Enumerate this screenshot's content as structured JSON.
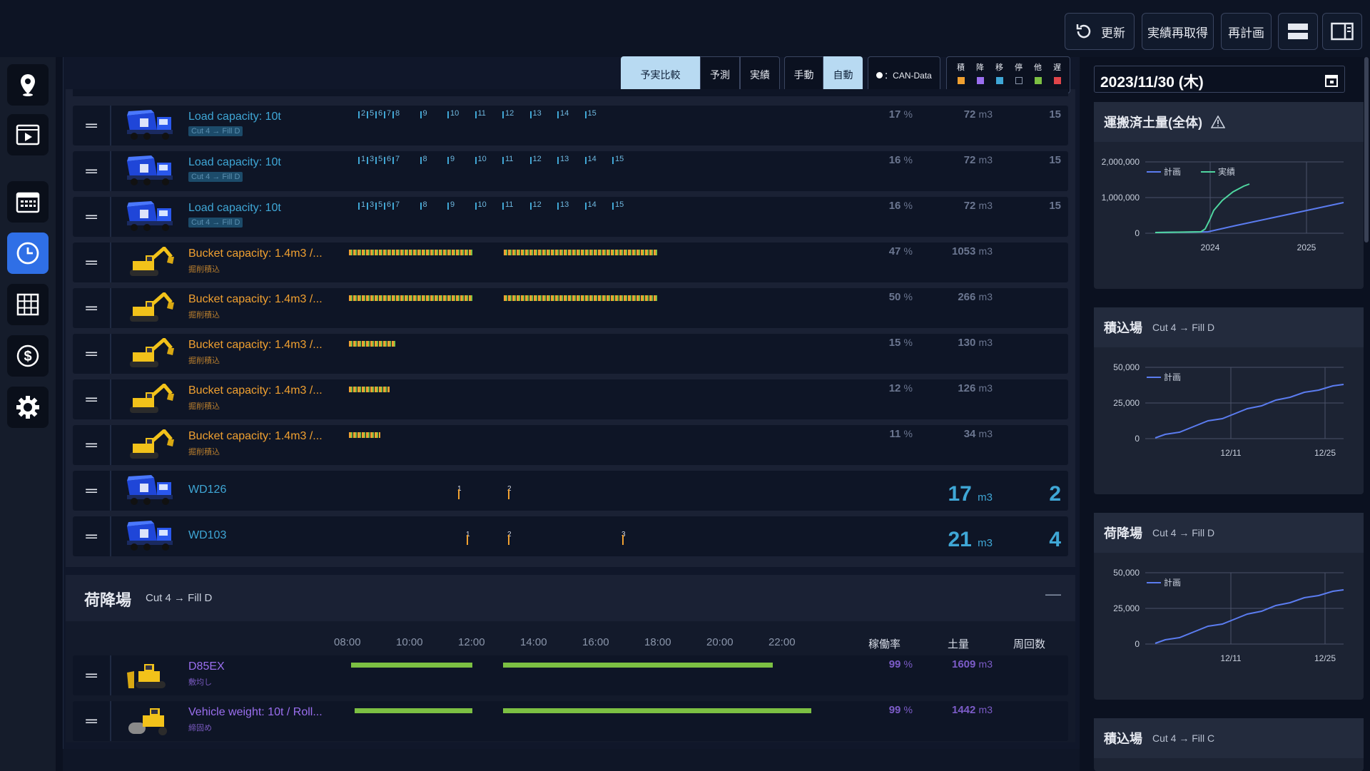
{
  "toolbar": {
    "refresh_label": "更新",
    "refetch_label": "実績再取得",
    "replan_label": "再計画"
  },
  "view_modes": {
    "compare": "予実比較",
    "forecast": "予測",
    "actual": "実績",
    "manual": "手動",
    "auto": "自動",
    "can_data": "：CAN-Data"
  },
  "legend": {
    "items": [
      {
        "label": "積",
        "color": "#f0a030"
      },
      {
        "label": "降",
        "color": "#9b6ff0"
      },
      {
        "label": "移",
        "color": "#3fa7d6"
      },
      {
        "label": "停",
        "color": "#0b1120"
      },
      {
        "label": "他",
        "color": "#7cc043"
      },
      {
        "label": "遅",
        "color": "#e0454a"
      }
    ]
  },
  "date_picker": {
    "value": "2023/11/30 (木)"
  },
  "loading_rows": [
    {
      "name": "Load capacity: 10t",
      "sub": "Cut 4 → Fill D",
      "pct": "17",
      "pct_unit": "%",
      "vol": "72",
      "vol_unit": "m3",
      "count": "15",
      "trips": [
        "2",
        "5",
        "6",
        "7",
        "8",
        "9",
        "10",
        "11",
        "12",
        "13",
        "14",
        "15"
      ]
    },
    {
      "name": "Load capacity: 10t",
      "sub": "Cut 4 → Fill D",
      "pct": "16",
      "pct_unit": "%",
      "vol": "72",
      "vol_unit": "m3",
      "count": "15",
      "trips": [
        "1",
        "3",
        "5",
        "6",
        "7",
        "8",
        "9",
        "10",
        "11",
        "12",
        "13",
        "14",
        "15"
      ]
    },
    {
      "name": "Load capacity: 10t",
      "sub": "Cut 4 → Fill D",
      "pct": "16",
      "pct_unit": "%",
      "vol": "72",
      "vol_unit": "m3",
      "count": "15",
      "trips": [
        "1",
        "3",
        "5",
        "6",
        "7",
        "8",
        "9",
        "10",
        "11",
        "12",
        "13",
        "14",
        "15"
      ]
    },
    {
      "name": "Bucket capacity: 1.4m3 /...",
      "sub": "掘削積込",
      "pct": "47",
      "pct_unit": "%",
      "vol": "1053",
      "vol_unit": "m3",
      "count": ""
    },
    {
      "name": "Bucket capacity: 1.4m3 /...",
      "sub": "掘削積込",
      "pct": "50",
      "pct_unit": "%",
      "vol": "266",
      "vol_unit": "m3",
      "count": ""
    },
    {
      "name": "Bucket capacity: 1.4m3 /...",
      "sub": "掘削積込",
      "pct": "15",
      "pct_unit": "%",
      "vol": "130",
      "vol_unit": "m3",
      "count": ""
    },
    {
      "name": "Bucket capacity: 1.4m3 /...",
      "sub": "掘削積込",
      "pct": "12",
      "pct_unit": "%",
      "vol": "126",
      "vol_unit": "m3",
      "count": ""
    },
    {
      "name": "Bucket capacity: 1.4m3 /...",
      "sub": "掘削積込",
      "pct": "11",
      "pct_unit": "%",
      "vol": "34",
      "vol_unit": "m3",
      "count": ""
    },
    {
      "name": "WD126",
      "sub": "",
      "pct": "",
      "pct_unit": "",
      "vol": "17",
      "vol_unit": "m3",
      "count": "2",
      "trips": [
        "1",
        "2"
      ]
    },
    {
      "name": "WD103",
      "sub": "",
      "pct": "",
      "pct_unit": "",
      "vol": "21",
      "vol_unit": "m3",
      "count": "4",
      "trips": [
        "1",
        "2",
        "3"
      ]
    }
  ],
  "unload_section": {
    "title": "荷降場",
    "route": "Cut 4 → Fill D",
    "collapse": "—",
    "time_axis": [
      "08:00",
      "10:00",
      "12:00",
      "14:00",
      "16:00",
      "18:00",
      "20:00",
      "22:00"
    ],
    "col_util": "稼働率",
    "col_volume": "土量",
    "col_trips": "周回数",
    "rows": [
      {
        "name": "D85EX",
        "sub": "敷均し",
        "pct": "99",
        "pct_unit": "%",
        "vol": "1609",
        "vol_unit": "m3"
      },
      {
        "name": "Vehicle weight: 10t / Roll...",
        "sub": "締固め",
        "pct": "99",
        "pct_unit": "%",
        "vol": "1442",
        "vol_unit": "m3"
      }
    ]
  },
  "cards": {
    "total": {
      "title": "運搬済土量(全体)",
      "legend_plan": "計画",
      "legend_actual": "実績",
      "y_ticks": [
        "2,000,000",
        "1,000,000",
        "0"
      ],
      "x_ticks": [
        "2024",
        "2025"
      ],
      "plan_color": "#5b7cf0",
      "actual_color": "#4fd6a0"
    },
    "loading": {
      "title": "積込場",
      "route": "Cut 4 → Fill D",
      "legend_plan": "計画",
      "y_ticks": [
        "50,000",
        "25,000",
        "0"
      ],
      "x_ticks": [
        "12/11",
        "12/25"
      ]
    },
    "unloading": {
      "title": "荷降場",
      "route": "Cut 4 → Fill D",
      "legend_plan": "計画",
      "y_ticks": [
        "50,000",
        "25,000",
        "0"
      ],
      "x_ticks": [
        "12/11",
        "12/25"
      ]
    },
    "loading2": {
      "title": "積込場",
      "route": "Cut 4 → Fill C"
    }
  }
}
